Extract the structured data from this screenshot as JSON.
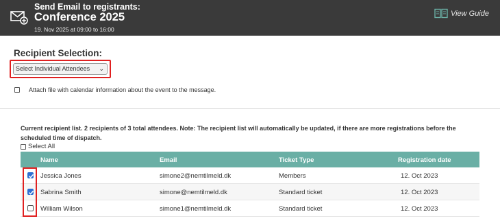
{
  "header": {
    "subtitle": "Send Email to registrants:",
    "title": "Conference 2025",
    "date": "19. Nov 2025 at 09:00 to 16:00",
    "guide_label": "View Guide"
  },
  "recipient": {
    "label": "Recipient Selection:",
    "selected": "Select Individual Attendees"
  },
  "attach": {
    "label": "Attach file with calendar information about the event to the message."
  },
  "note": "Current recipient list. 2 recipients of 3 total attendees. Note: The recipient list will automatically be updated, if there are more registrations before the scheduled time of dispatch.",
  "select_all": "Select All",
  "table": {
    "columns": [
      "Name",
      "Email",
      "Ticket Type",
      "Registration date"
    ],
    "rows": [
      {
        "checked": true,
        "name": "Jessica Jones",
        "email": "simone2@nemtilmeld.dk",
        "ticket": "Members",
        "date": "12. Oct 2023"
      },
      {
        "checked": true,
        "name": "Sabrina Smith",
        "email": "simone@nemtilmeld.dk",
        "ticket": "Standard ticket",
        "date": "12. Oct 2023"
      },
      {
        "checked": false,
        "name": "William Wilson",
        "email": "simone1@nemtilmeld.dk",
        "ticket": "Standard ticket",
        "date": "12. Oct 2023"
      }
    ]
  },
  "colors": {
    "header_bg": "#3a3a3a",
    "table_header_bg": "#6aafa5",
    "highlight": "#e02020",
    "checkbox_on": "#2f6fd2"
  },
  "icons": {
    "header": "envelope-plus-icon",
    "guide": "book-icon",
    "select": "chevron-down-icon"
  }
}
